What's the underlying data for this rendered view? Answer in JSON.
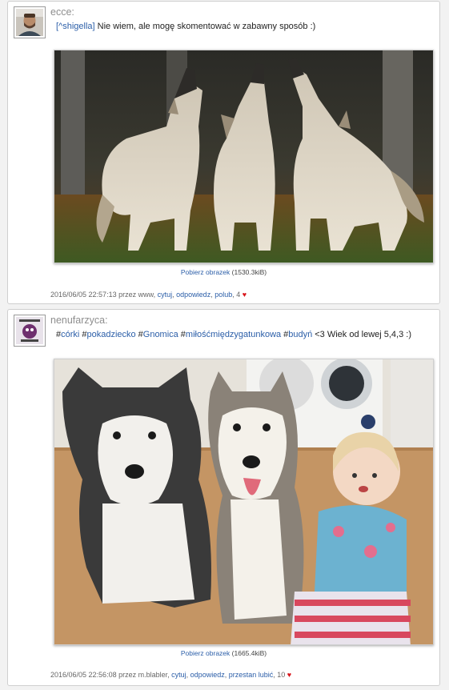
{
  "posts": [
    {
      "username": "ecce:",
      "mention": "[^shigella]",
      "text": " Nie wiem, ale mogę skomentować w zabawny sposób :)",
      "download_label": "Pobierz obrazek",
      "download_size": "(1530.3kiB)",
      "timestamp": "2016/06/05 22:57:13",
      "by": "przez www,",
      "actions": [
        "cytuj",
        "odpowiedz",
        "polub"
      ],
      "likes": "4",
      "heart_icon": "heart-icon",
      "like_color": "#d8151b"
    },
    {
      "username": "nenufarzyca:",
      "tags": [
        "#córki",
        "#pokadziecko",
        "#Gnomica",
        "#miłośćmiędzygatunkowa",
        "#budyń"
      ],
      "text": "<3 Wiek od lewej 5,4,3 :)",
      "download_label": "Pobierz obrazek",
      "download_size": "(1665.4kiB)",
      "timestamp": "2016/06/05 22:56:08",
      "by": "przez m.blabler,",
      "actions": [
        "cytuj",
        "odpowiedz",
        "przestan lubić"
      ],
      "likes": "10",
      "heart_icon": "heart-icon",
      "like_color": "#d8151b"
    }
  ]
}
